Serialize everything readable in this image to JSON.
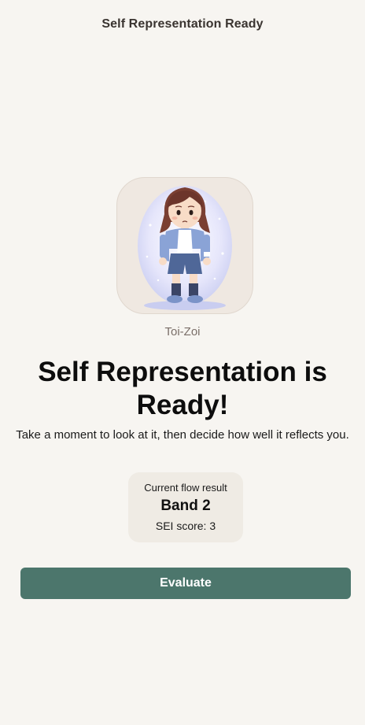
{
  "header": {
    "title": "Self Representation Ready"
  },
  "avatar": {
    "name": "Toi-Zoi",
    "icon": "child-avatar-illustration"
  },
  "main": {
    "title": "Self Representation is Ready!",
    "subtitle": "Take a moment to look at it, then decide how well it reflects you."
  },
  "result": {
    "label": "Current flow result",
    "band": "Band 2",
    "score": "SEI score: 3"
  },
  "actions": {
    "evaluate_label": "Evaluate"
  },
  "colors": {
    "background": "#f7f5f1",
    "accent": "#4c766c",
    "card": "#efebe4"
  }
}
